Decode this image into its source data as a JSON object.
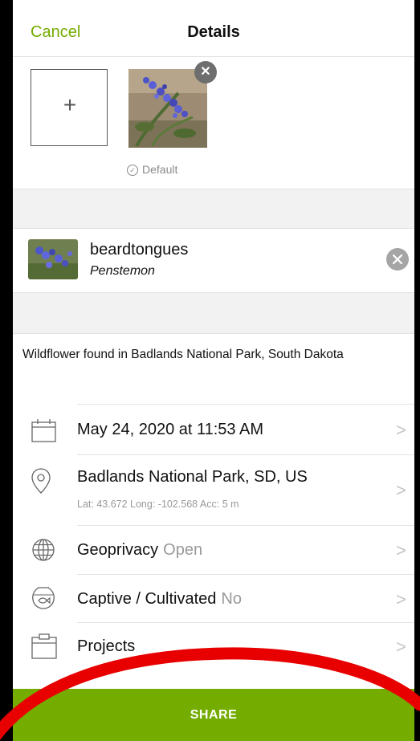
{
  "nav": {
    "cancel_label": "Cancel",
    "title": "Details"
  },
  "photos": {
    "add_symbol": "+",
    "remove_symbol": "✕",
    "default_label": "Default"
  },
  "taxon": {
    "common_name": "beardtongues",
    "scientific_name": "Penstemon"
  },
  "description": "Wildflower found in Badlands National Park, South Dakota",
  "rows": {
    "date": {
      "text": "May 24, 2020 at 11:53 AM",
      "icon": "calendar-icon"
    },
    "location": {
      "text": "Badlands National Park, SD, US",
      "details": "Lat: 43.672  Long: -102.568  Acc: 5 m",
      "icon": "location-pin-icon"
    },
    "geoprivacy": {
      "label": "Geoprivacy",
      "value": "Open",
      "icon": "globe-icon"
    },
    "captive": {
      "label": "Captive / Cultivated",
      "value": "No",
      "icon": "fishbowl-icon"
    },
    "projects": {
      "label": "Projects",
      "icon": "clipboard-icon"
    }
  },
  "chevron": ">",
  "share_label": "SHARE",
  "colors": {
    "accent": "#74ac00",
    "annotation": "#e80000"
  }
}
